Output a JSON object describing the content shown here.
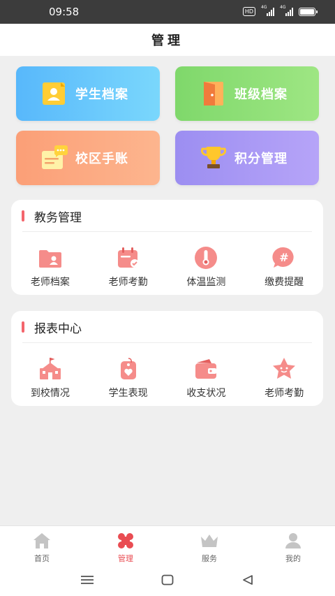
{
  "status_bar": {
    "time": "09:58",
    "hd_label": "HD",
    "sim1_label": "4G",
    "sim2_label": "4G",
    "battery": 1.0
  },
  "header": {
    "title": "管理"
  },
  "tiles": [
    {
      "label": "学生档案",
      "icon": "student-file-icon"
    },
    {
      "label": "班级档案",
      "icon": "door-icon"
    },
    {
      "label": "校区手账",
      "icon": "chat-notebook-icon"
    },
    {
      "label": "积分管理",
      "icon": "trophy-icon"
    }
  ],
  "sections": [
    {
      "title": "教务管理",
      "items": [
        {
          "label": "老师档案",
          "icon": "folder-person-icon"
        },
        {
          "label": "老师考勤",
          "icon": "calendar-check-icon"
        },
        {
          "label": "体温监测",
          "icon": "thermometer-icon"
        },
        {
          "label": "缴费提醒",
          "icon": "hash-bubble-icon"
        }
      ]
    },
    {
      "title": "报表中心",
      "items": [
        {
          "label": "到校情况",
          "icon": "school-icon"
        },
        {
          "label": "学生表现",
          "icon": "tag-heart-icon"
        },
        {
          "label": "收支状况",
          "icon": "wallet-icon"
        },
        {
          "label": "老师考勤",
          "icon": "star-face-icon"
        }
      ]
    }
  ],
  "tabbar": {
    "items": [
      {
        "label": "首页",
        "icon": "home-icon",
        "active": false
      },
      {
        "label": "管理",
        "icon": "clover-icon",
        "active": true
      },
      {
        "label": "服务",
        "icon": "crown-icon",
        "active": false
      },
      {
        "label": "我的",
        "icon": "user-icon",
        "active": false
      }
    ]
  },
  "colors": {
    "accent": "#e94c52",
    "section_bar": "#f4656c",
    "icon_pink": "#f3827f"
  },
  "navigation_bar": {
    "buttons": [
      "menu-icon",
      "home-square-icon",
      "back-triangle-icon"
    ]
  }
}
